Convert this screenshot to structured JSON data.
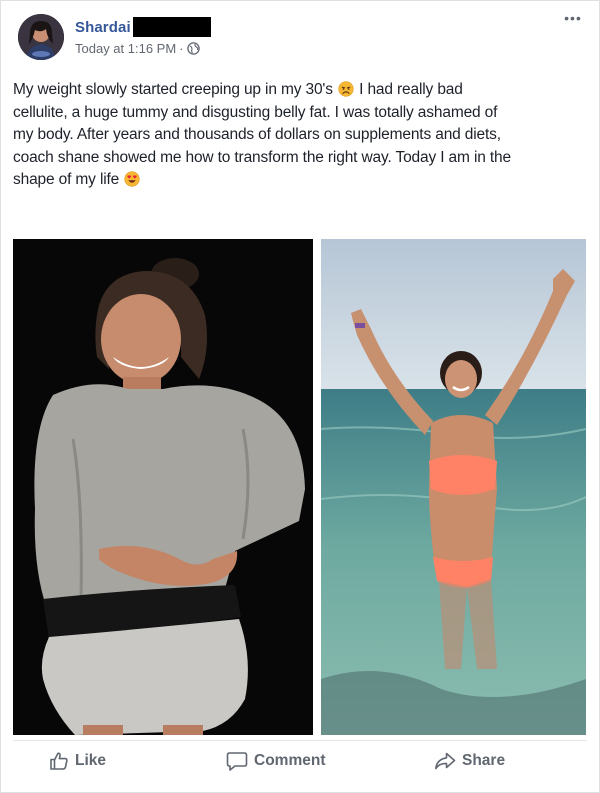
{
  "post": {
    "author": {
      "name": "Shardai"
    },
    "timestamp": "Today at 1:16 PM",
    "separator": "·",
    "more_label": "•••",
    "text_lines": [
      {
        "before": "My weight slowly started creeping up in my 30's ",
        "emoji": "sad-face-emoji",
        "after": " I had really bad"
      },
      {
        "before": "cellulite, a huge tummy and disgusting belly fat. I was totally ashamed of"
      },
      {
        "before": "my body. After years and thousands of dollars on supplements and diets,"
      },
      {
        "before": "coach shane showed me how to transform the right way. Today I am in the"
      },
      {
        "before": "shape of my life ",
        "emoji": "heart-eyes-emoji"
      }
    ],
    "photos": [
      {
        "name": "before-photo"
      },
      {
        "name": "after-photo"
      }
    ]
  },
  "actions": {
    "like_label": "Like",
    "comment_label": "Comment",
    "share_label": "Share"
  },
  "colors": {
    "name_link": "#365899",
    "meta_text": "#616770",
    "action_text": "#606770",
    "border": "#dddfe2"
  }
}
